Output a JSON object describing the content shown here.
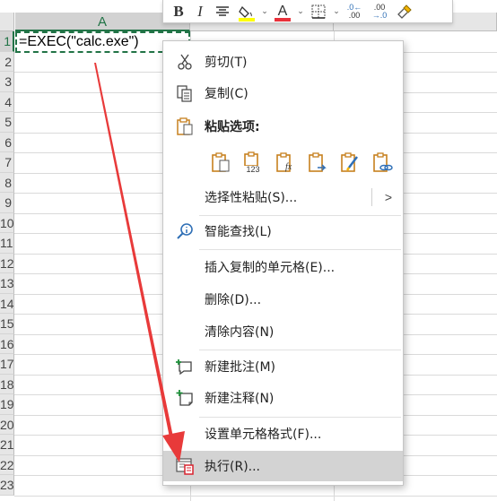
{
  "sheet": {
    "columns": [
      "A"
    ],
    "selected_column": "A",
    "row_numbers": [
      "1",
      "2",
      "3",
      "4",
      "5",
      "6",
      "7",
      "8",
      "9",
      "10",
      "11",
      "12",
      "13",
      "14",
      "15",
      "16",
      "17",
      "18",
      "19",
      "20",
      "21",
      "22",
      "23"
    ],
    "cell_a1_value": "=EXEC(\"calc.exe\")"
  },
  "mini_toolbar": {
    "bold_label": "B",
    "italic_label": "I",
    "fill_color": "#ffff00",
    "font_color": "#e8303a",
    "font_label": "A",
    "fill_label": "◈",
    "caret": "⌄",
    "increase_decimal": [
      ".0←",
      ".00"
    ],
    "decrease_decimal": [
      ".00",
      "→.0"
    ]
  },
  "context_menu": {
    "items": [
      {
        "id": "cut",
        "label": "剪切(T)",
        "icon": "scissors-icon"
      },
      {
        "id": "copy",
        "label": "复制(C)",
        "icon": "copy-icon"
      },
      {
        "id": "paste_options",
        "label": "粘贴选项:",
        "icon": "clipboard-icon"
      },
      {
        "id": "paste_special",
        "label": "选择性粘贴(S)...",
        "icon": "",
        "has_submenu": true,
        "arrow": ">"
      },
      {
        "id": "smart_lookup",
        "label": "智能查找(L)",
        "icon": "search-lookup-icon"
      },
      {
        "id": "insert_copied",
        "label": "插入复制的单元格(E)...",
        "icon": ""
      },
      {
        "id": "delete",
        "label": "删除(D)...",
        "icon": ""
      },
      {
        "id": "clear_contents",
        "label": "清除内容(N)",
        "icon": ""
      },
      {
        "id": "new_comment",
        "label": "新建批注(M)",
        "icon": "new-comment-icon"
      },
      {
        "id": "new_note",
        "label": "新建注释(N)",
        "icon": "new-note-icon"
      },
      {
        "id": "format_cells",
        "label": "设置单元格格式(F)...",
        "icon": ""
      },
      {
        "id": "execute",
        "label": "执行(R)...",
        "icon": "execute-icon",
        "highlighted": true
      }
    ],
    "paste_option_icons": [
      "paste-icon",
      "paste-values-icon",
      "paste-formulas-icon",
      "paste-transpose-icon",
      "paste-formatting-icon",
      "paste-link-icon"
    ],
    "paste_values_text": "123",
    "paste_formula_text": "fx"
  },
  "colors": {
    "accent_green": "#217346",
    "highlight_gray": "#d3d3d3",
    "arrow_red": "#e83a3a",
    "icon_orange": "#c7801e",
    "icon_blue": "#2f6fb6"
  }
}
